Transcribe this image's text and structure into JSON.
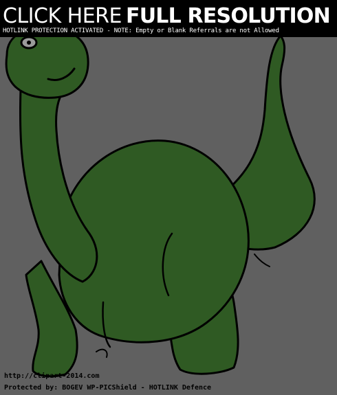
{
  "banner": {
    "click_here": "CLICK HERE",
    "full_resolution": "FULL RESOLUTION",
    "hotlink_note": "HOTLINK PROTECTION ACTIVATED - NOTE: Empty or Blank Referrals are not Allowed"
  },
  "footer": {
    "url": "http://clipart-2014.com",
    "protected_by": "Protected by: BOGEV WP-PICShield - HOTLINK Defence"
  },
  "colors": {
    "background": "#606060",
    "dino_green": "#2f5a23",
    "banner_bg": "#000000"
  }
}
